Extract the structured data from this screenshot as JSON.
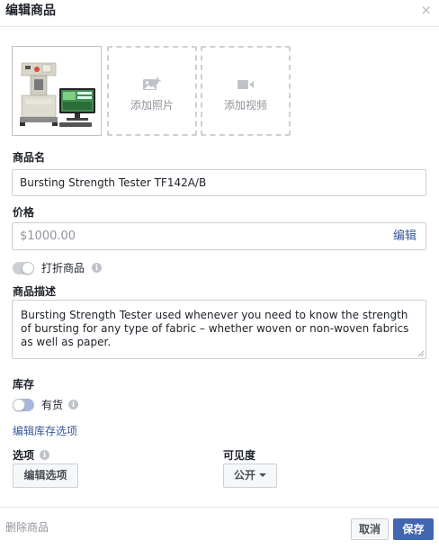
{
  "dialog": {
    "title": "编辑商品",
    "close_symbol": "×"
  },
  "media": {
    "add_photo_label": "添加照片",
    "add_video_label": "添加视频"
  },
  "product_name": {
    "label": "商品名",
    "value": "Bursting Strength Tester TF142A/B"
  },
  "price": {
    "label": "价格",
    "value": "$1000.00",
    "edit_label": "编辑"
  },
  "discount": {
    "label": "打折商品",
    "enabled": false
  },
  "description": {
    "label": "商品描述",
    "value": "Bursting Strength Tester used whenever you need to know the strength of bursting for any type of fabric – whether woven or non-woven fabrics as well as paper."
  },
  "inventory": {
    "label": "库存",
    "toggle_label": "有货",
    "in_stock": true,
    "edit_options_link": "编辑库存选项"
  },
  "options": {
    "label": "选项",
    "edit_button": "编辑选项"
  },
  "visibility": {
    "label": "可见度",
    "selected": "公开"
  },
  "footer": {
    "delete_label": "删除商品",
    "cancel_label": "取消",
    "save_label": "保存"
  },
  "info_symbol": "i",
  "colors": {
    "link": "#365899",
    "primary_button": "#4267b2",
    "muted_text": "#90949c",
    "border": "#ccd0d5"
  },
  "icons": {
    "close": "close-icon",
    "add_photo": "add-photo-icon",
    "add_video": "add-video-icon",
    "info": "info-icon",
    "caret": "caret-down-icon"
  }
}
